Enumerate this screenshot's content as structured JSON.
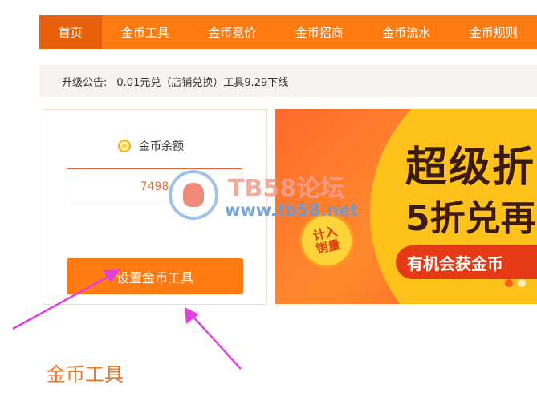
{
  "nav": {
    "items": [
      {
        "label": "首页",
        "active": true
      },
      {
        "label": "金币工具",
        "active": false
      },
      {
        "label": "金币竞价",
        "active": false
      },
      {
        "label": "金币招商",
        "active": false
      },
      {
        "label": "金币流水",
        "active": false
      },
      {
        "label": "金币规则",
        "active": false
      }
    ]
  },
  "notice": {
    "label": "升级公告:",
    "text": "0.01元兑（店铺兑换）工具9.29下线"
  },
  "balance": {
    "label": "金币余额",
    "value": "7498",
    "icon": "coin-icon"
  },
  "actions": {
    "set_tool_label": "设置金币工具"
  },
  "banner": {
    "title": "超级折",
    "subtitle": "5折兑再",
    "ribbon": "有机会获金币",
    "badge_line1": "计入",
    "badge_line2": "销量"
  },
  "watermark": {
    "title": "TB58论坛",
    "url": "www.tb58.net"
  },
  "section": {
    "title": "金币工具"
  },
  "colors": {
    "accent": "#ff7a10",
    "nav_active": "#e8600a",
    "annotation_arrow": "#e040e0"
  }
}
